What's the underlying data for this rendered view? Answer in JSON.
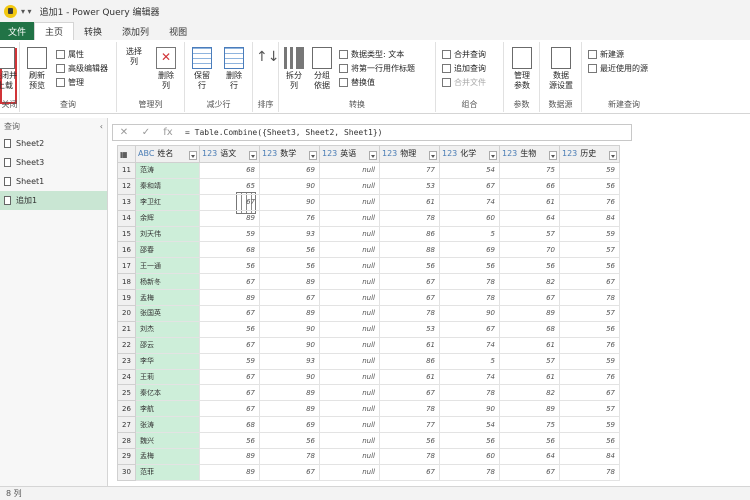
{
  "window": {
    "title": "追加1 - Power Query 编辑器"
  },
  "tabs": [
    "文件",
    "主页",
    "转换",
    "添加列",
    "视图"
  ],
  "ribbon": {
    "groups": [
      {
        "label": "关闭",
        "buttons": [
          "关闭并\n上载"
        ]
      },
      {
        "label": "查询",
        "buttons": [
          "刷新\n预览"
        ],
        "small": [
          "属性",
          "高级编辑器",
          "管理"
        ]
      },
      {
        "label": "管理列",
        "buttons": [
          "选择\n列",
          "删除\n列"
        ]
      },
      {
        "label": "减少行",
        "buttons": [
          "保留\n行",
          "删除\n行"
        ]
      },
      {
        "label": "排序",
        "buttons": []
      },
      {
        "label": "转换",
        "buttons": [
          "拆分\n列",
          "分组\n依据"
        ],
        "small": [
          "数据类型: 文本",
          "将第一行用作标题",
          "替换值"
        ]
      },
      {
        "label": "组合",
        "small": [
          "合并查询",
          "追加查询",
          "合并文件"
        ]
      },
      {
        "label": "参数",
        "buttons": [
          "管理\n参数"
        ]
      },
      {
        "label": "数据源",
        "buttons": [
          "数据\n源设置"
        ]
      },
      {
        "label": "新建查询",
        "small": [
          "新建源",
          "最近使用的源"
        ]
      }
    ]
  },
  "formula": {
    "text": "= Table.Combine({Sheet3, Sheet2, Sheet1})"
  },
  "queries": {
    "header": "查询",
    "items": [
      "Sheet2",
      "Sheet3",
      "Sheet1",
      "追加1"
    ],
    "selected_index": 3
  },
  "table": {
    "columns": [
      "姓名",
      "语文",
      "数学",
      "英语",
      "物理",
      "化学",
      "生物",
      "历史"
    ],
    "column_types": [
      "ABC",
      "123",
      "123",
      "123",
      "123",
      "123",
      "123",
      "123"
    ],
    "rows": [
      {
        "n": "11",
        "name": "范涛",
        "v": [
          "68",
          "69",
          "null",
          "77",
          "54",
          "75",
          "59"
        ]
      },
      {
        "n": "12",
        "name": "秦和靖",
        "v": [
          "65",
          "90",
          "null",
          "53",
          "67",
          "66",
          "56"
        ]
      },
      {
        "n": "13",
        "name": "李卫红",
        "v": [
          "67",
          "90",
          "null",
          "61",
          "74",
          "61",
          "76"
        ]
      },
      {
        "n": "14",
        "name": "余辉",
        "v": [
          "89",
          "76",
          "null",
          "78",
          "60",
          "64",
          "84"
        ]
      },
      {
        "n": "15",
        "name": "刘天伟",
        "v": [
          "59",
          "93",
          "null",
          "86",
          "5",
          "57",
          "59"
        ]
      },
      {
        "n": "16",
        "name": "邵春",
        "v": [
          "68",
          "56",
          "null",
          "88",
          "69",
          "70",
          "57"
        ]
      },
      {
        "n": "17",
        "name": "王一通",
        "v": [
          "56",
          "56",
          "null",
          "56",
          "56",
          "56",
          "56"
        ]
      },
      {
        "n": "18",
        "name": "杨新冬",
        "v": [
          "67",
          "89",
          "null",
          "67",
          "78",
          "82",
          "67"
        ]
      },
      {
        "n": "19",
        "name": "孟梅",
        "v": [
          "89",
          "67",
          "null",
          "67",
          "78",
          "67",
          "78"
        ]
      },
      {
        "n": "20",
        "name": "张国英",
        "v": [
          "67",
          "89",
          "null",
          "78",
          "90",
          "89",
          "57"
        ]
      },
      {
        "n": "21",
        "name": "刘杰",
        "v": [
          "56",
          "90",
          "null",
          "53",
          "67",
          "68",
          "56"
        ]
      },
      {
        "n": "22",
        "name": "邵云",
        "v": [
          "67",
          "90",
          "null",
          "61",
          "74",
          "61",
          "76"
        ]
      },
      {
        "n": "23",
        "name": "李华",
        "v": [
          "59",
          "93",
          "null",
          "86",
          "5",
          "57",
          "59"
        ]
      },
      {
        "n": "24",
        "name": "王莉",
        "v": [
          "67",
          "90",
          "null",
          "61",
          "74",
          "61",
          "76"
        ]
      },
      {
        "n": "25",
        "name": "秦亿本",
        "v": [
          "67",
          "89",
          "null",
          "67",
          "78",
          "82",
          "67"
        ]
      },
      {
        "n": "26",
        "name": "李航",
        "v": [
          "67",
          "89",
          "null",
          "78",
          "90",
          "89",
          "57"
        ]
      },
      {
        "n": "27",
        "name": "张涛",
        "v": [
          "68",
          "69",
          "null",
          "77",
          "54",
          "75",
          "59"
        ]
      },
      {
        "n": "28",
        "name": "魏兴",
        "v": [
          "56",
          "56",
          "null",
          "56",
          "56",
          "56",
          "56"
        ]
      },
      {
        "n": "29",
        "name": "孟梅",
        "v": [
          "89",
          "78",
          "null",
          "78",
          "60",
          "64",
          "84"
        ]
      },
      {
        "n": "30",
        "name": "范菲",
        "v": [
          "89",
          "67",
          "null",
          "67",
          "78",
          "67",
          "78"
        ]
      }
    ]
  },
  "status": {
    "text": "8 列"
  }
}
